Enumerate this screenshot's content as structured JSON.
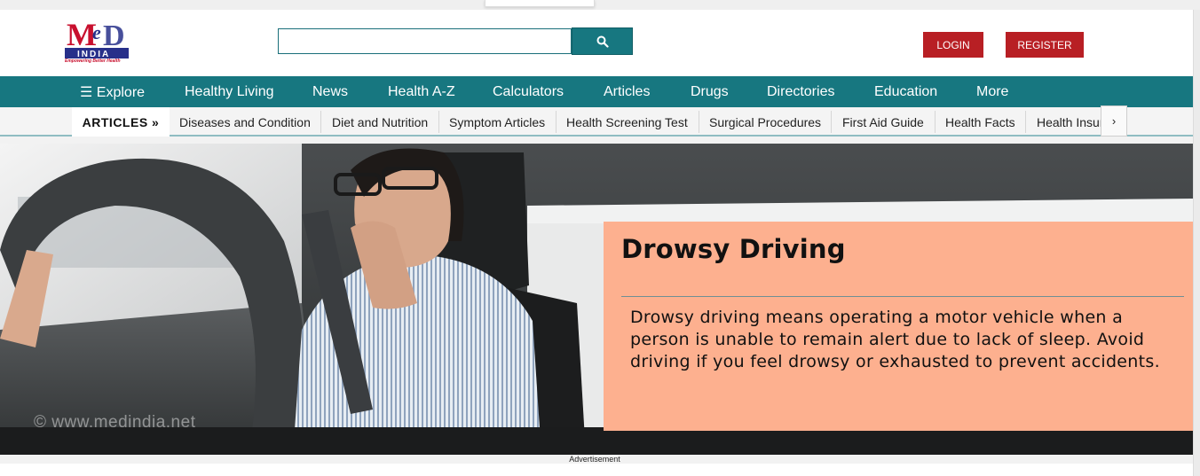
{
  "logo": {
    "alt_text": "MeD INDIA",
    "tagline": "Empowering Better Health"
  },
  "header": {
    "search_placeholder": "",
    "login_label": "LOGIN",
    "register_label": "REGISTER"
  },
  "main_nav": [
    "☰  Explore",
    "Healthy Living",
    "News",
    "Health A-Z",
    "Calculators",
    "Articles",
    "Drugs",
    "Directories",
    "Education",
    "More"
  ],
  "sub_nav": {
    "section_label": "ARTICLES  »",
    "items": [
      "Diseases and Condition",
      "Diet and Nutrition",
      "Symptom Articles",
      "Health Screening Test",
      "Surgical Procedures",
      "First Aid Guide",
      "Health Facts",
      "Health Insurance"
    ],
    "next_glyph": "›"
  },
  "hero": {
    "watermark": "© www.medindia.net",
    "title": "Drowsy Driving",
    "description": "Drowsy driving means operating a motor vehicle when a person is unable to remain alert due to lack of sleep. Avoid driving if you feel drowsy or exhausted to prevent accidents."
  },
  "advertisement_label": "Advertisement",
  "colors": {
    "brand_teal": "#177780",
    "brand_red": "#b81f24",
    "callout_bg": "#fdb08f"
  }
}
